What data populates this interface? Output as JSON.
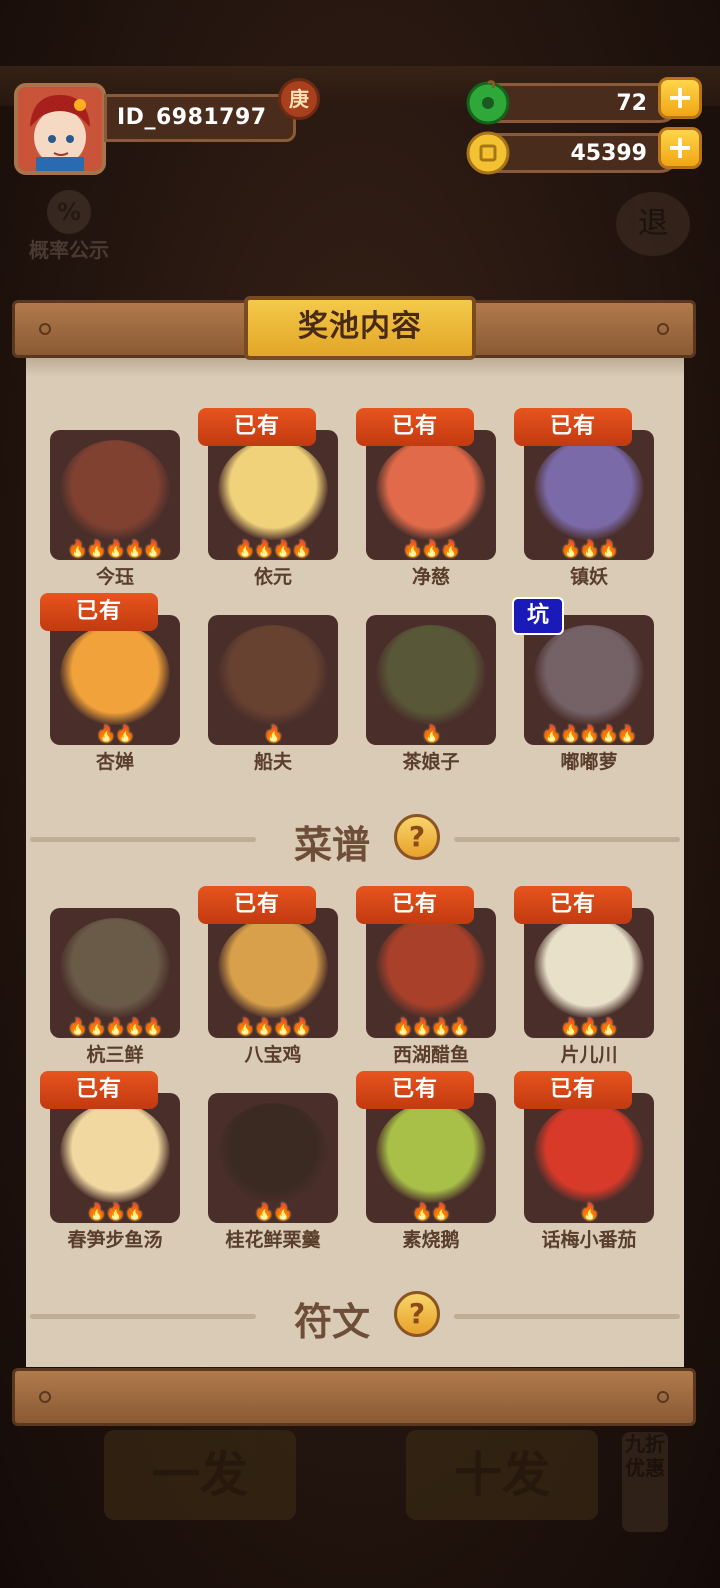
{
  "header": {
    "user_id": "ID_6981797",
    "vip_badge": "庚",
    "jade": {
      "value": "72",
      "icon": "jade-icon"
    },
    "coins": {
      "value": "45399",
      "icon": "coin-icon"
    },
    "plus_label": "+"
  },
  "background": {
    "prob_label": "概率公示",
    "prob_icon_text": "%",
    "exit_label": "退",
    "single_draw": "一发",
    "ten_draw": "十发",
    "discount": "九折优惠"
  },
  "panel": {
    "title": "奖池内容",
    "owned_label": "已有",
    "pit_label": "坑",
    "characters": [
      {
        "name": "今珏",
        "owned": false,
        "pit": false,
        "flames": 5
      },
      {
        "name": "依元",
        "owned": true,
        "pit": false,
        "flames": 4
      },
      {
        "name": "净慈",
        "owned": true,
        "pit": false,
        "flames": 3
      },
      {
        "name": "镇妖",
        "owned": true,
        "pit": false,
        "flames": 3
      },
      {
        "name": "杏婵",
        "owned": true,
        "pit": false,
        "flames": 2
      },
      {
        "name": "船夫",
        "owned": false,
        "pit": false,
        "flames": 1
      },
      {
        "name": "茶娘子",
        "owned": false,
        "pit": false,
        "flames": 1
      },
      {
        "name": "嘟嘟萝",
        "owned": false,
        "pit": true,
        "flames": 5
      }
    ],
    "recipes_title": "菜谱",
    "recipes": [
      {
        "name": "杭三鲜",
        "owned": false,
        "flames": 5
      },
      {
        "name": "八宝鸡",
        "owned": true,
        "flames": 4
      },
      {
        "name": "西湖醋鱼",
        "owned": true,
        "flames": 4
      },
      {
        "name": "片儿川",
        "owned": true,
        "flames": 3
      },
      {
        "name": "春笋步鱼汤",
        "owned": true,
        "flames": 3
      },
      {
        "name": "桂花鲜栗羹",
        "owned": false,
        "flames": 2
      },
      {
        "name": "素烧鹅",
        "owned": true,
        "flames": 2
      },
      {
        "name": "话梅小番茄",
        "owned": true,
        "flames": 1
      }
    ],
    "runes_title": "符文",
    "help_label": "?"
  },
  "colors": {
    "owned_tag": "#d9471a",
    "pit_tag": "#1a1ab8",
    "paper": "#d9cbb6",
    "card_bg": "#4a2e2a",
    "title_plate": "#e9b43a"
  }
}
